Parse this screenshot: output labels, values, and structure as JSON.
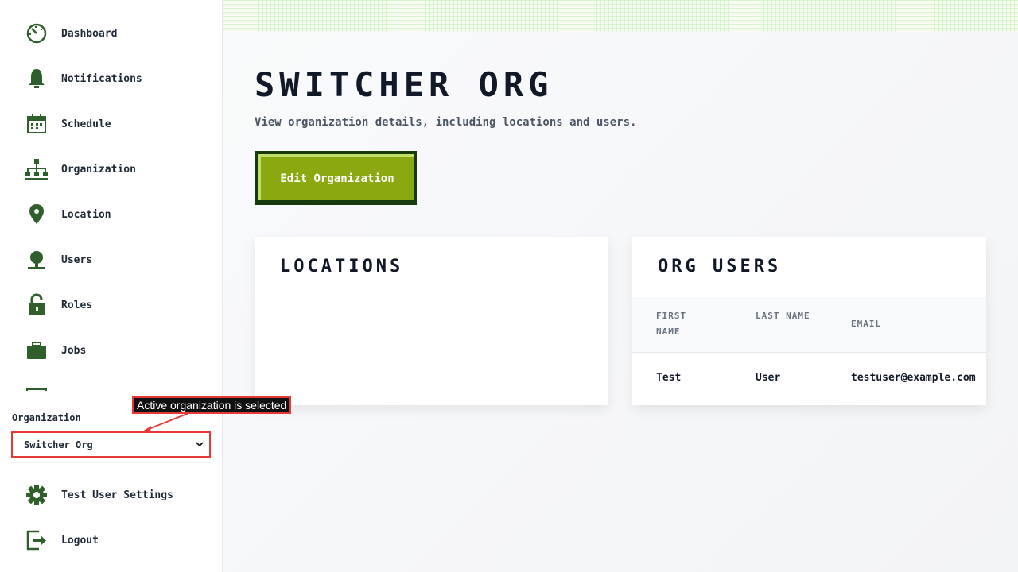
{
  "sidebar": {
    "items": [
      {
        "label": "Dashboard",
        "icon": "dashboard-icon"
      },
      {
        "label": "Notifications",
        "icon": "bell-icon"
      },
      {
        "label": "Schedule",
        "icon": "calendar-icon"
      },
      {
        "label": "Organization",
        "icon": "org-chart-icon"
      },
      {
        "label": "Location",
        "icon": "map-pin-icon"
      },
      {
        "label": "Users",
        "icon": "user-icon"
      },
      {
        "label": "Roles",
        "icon": "lock-icon"
      },
      {
        "label": "Jobs",
        "icon": "briefcase-icon"
      }
    ],
    "org_label": "Organization",
    "org_selected": "Switcher Org",
    "settings_label": "Test User Settings",
    "logout_label": "Logout"
  },
  "annotation": {
    "text": "Active organization is selected"
  },
  "main": {
    "title": "Switcher Org",
    "subtitle": "View organization details, including locations and users.",
    "edit_button_label": "Edit Organization",
    "locations_card": {
      "title": "Locations"
    },
    "users_card": {
      "title": "Org Users",
      "columns": [
        "First Name",
        "Last Name",
        "Email"
      ],
      "rows": [
        {
          "first": "Test",
          "last": "User",
          "email": "testuser@example.com"
        }
      ]
    }
  },
  "colors": {
    "icon_green": "#2f5f2a",
    "button_dark": "#173b0c",
    "button_fill": "#8aa810",
    "button_highlight": "#c4de6a",
    "annotation_red": "#e53935"
  }
}
